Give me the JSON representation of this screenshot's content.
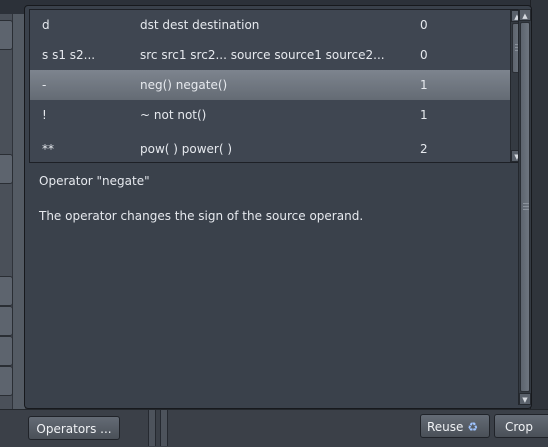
{
  "operators": [
    {
      "symbol": "d",
      "names": "dst dest destination",
      "value": "0",
      "selected": false
    },
    {
      "symbol": "s s1 s2...",
      "names": "src src1 src2... source source1 source2...",
      "value": "0",
      "selected": false
    },
    {
      "symbol": "-",
      "names": "neg() negate()",
      "value": "1",
      "selected": true
    },
    {
      "symbol": "!",
      "names": "~ not not()",
      "value": "1",
      "selected": false
    },
    {
      "symbol": "**",
      "names": "pow( ) power( )",
      "value": "2",
      "selected": false
    }
  ],
  "description": {
    "title": "Operator \"negate\"",
    "text": "The operator changes the sign of the source operand."
  },
  "bottom": {
    "operators_button": "Operators ...",
    "reuse_button": "Reuse",
    "crop_button": "Crop"
  },
  "icons": {
    "scroll_up": "up-arrow-icon",
    "scroll_down": "down-arrow-icon",
    "reuse": "recycle-icon"
  },
  "colors": {
    "selected_row": "#737a84",
    "panel": "#3a414b"
  }
}
